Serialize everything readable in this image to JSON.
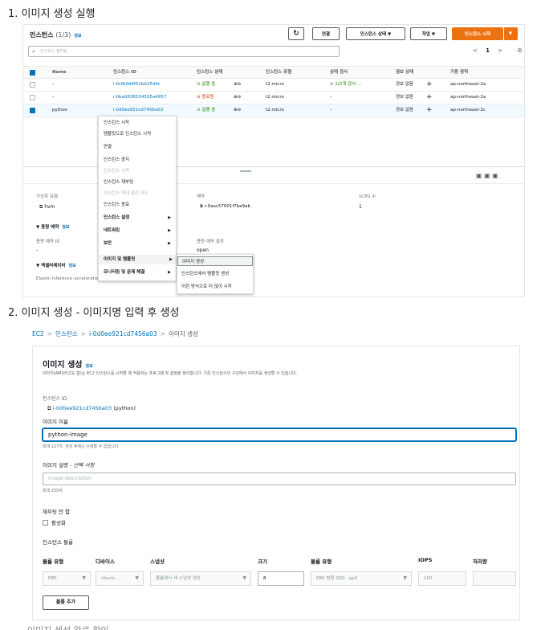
{
  "step1": "1. 이미지 생성 실행",
  "step2": "2. 이미지 생성 - 이미지명 입력 후 생성",
  "instances": {
    "title": "인스턴스",
    "count": "(1/3)",
    "info": "정보",
    "refresh_icon": "refresh-icon",
    "buttons": {
      "connect": "연결",
      "state": "인스턴스 상태 ▼",
      "actions": "작업 ▼",
      "launch": "인스턴스 시작",
      "launch_more": "▼"
    },
    "search_placeholder": "인스턴스 필터링",
    "pager": {
      "prev": "<",
      "page": "1",
      "next": ">",
      "settings": "⚙"
    },
    "columns": [
      "Name",
      "인스턴스 ID",
      "인스턴스 상태",
      "인스턴스 유형",
      "상태 검사",
      "경보 상태",
      "가용 영역"
    ],
    "rows": [
      {
        "name": "–",
        "id": "i-0cfb0d4f51bb25dfd",
        "state": "⊙ 실행 중",
        "zoom": "⊕⊖",
        "type": "t2.micro",
        "check": "⊙ 2/2개 검사 ...",
        "alarm": "경보 없음",
        "plus": "+",
        "az": "ap-northeast-2a"
      },
      {
        "name": "–",
        "id": "i-0ba0836554595a4957",
        "state": "⊖ 종료됨",
        "zoom": "⊕⊖",
        "type": "t2.micro",
        "check": "–",
        "alarm": "경보 없음",
        "plus": "+",
        "az": "ap-northeast-2a"
      },
      {
        "name": "python",
        "id": "i-0d0ee921cd7456a03",
        "state": "⊙ 실행 중",
        "zoom": "⊕⊖",
        "type": "t2.micro",
        "check": "–",
        "alarm": "경보 없음",
        "plus": "+",
        "az": "ap-northeast-2c"
      }
    ],
    "details": {
      "virt_label": "가상화 유형",
      "virt_value": "hvm",
      "lease_label": "예약",
      "lease_value": "r-0aac57001f7be9ab",
      "vcpu_label": "vCPU 수",
      "vcpu_value": "1",
      "capacity_label": "▼ 용량 예약",
      "capacity_info": "정보",
      "cap_id_label": "용량 예약 ID",
      "cap_id_value": "–",
      "cap_setting_label": "용량 예약 설정",
      "cap_setting_value": "open",
      "accel_label": "▼ 액셀러레이터",
      "accel_info": "정보",
      "elastic_label": "Elastic inference accelerator ID"
    },
    "menu": [
      {
        "label": "인스턴스 시작",
        "dis": false
      },
      {
        "label": "템플릿으로 인스턴스 시작",
        "dis": false
      },
      {
        "label": "연결",
        "dis": false
      },
      {
        "label": "인스턴스 중지",
        "dis": false
      },
      {
        "label": "인스턴스 시작",
        "dis": true
      },
      {
        "label": "인스턴스 재부팅",
        "dis": false
      },
      {
        "label": "인스턴스 최대 절전 모드",
        "dis": true
      },
      {
        "label": "인스턴스 종료",
        "dis": false
      },
      {
        "label": "인스턴스 설정",
        "sub": true
      },
      {
        "label": "네트워킹",
        "sub": true
      },
      {
        "label": "보안",
        "sub": true
      },
      {
        "label": "이미지 및 템플릿",
        "sub": true,
        "hl": true
      },
      {
        "label": "모니터링 및 문제 해결",
        "sub": true
      }
    ],
    "submenu": [
      "이미지 생성",
      "인스턴스에서 템플릿 생성",
      "이런 방식으로 더 많이 시작"
    ]
  },
  "create": {
    "breadcrumb": [
      "EC2",
      "인스턴스",
      "i-0d0ee921cd7456a03",
      "이미지 생성"
    ],
    "title": "이미지 생성",
    "info": "정보",
    "description": "이미지(AMI)라고도 함)는 EC2 인스턴스를 시작할 때 적용되는 프로그램 및 설정을 정의합니다. 기존 인스턴스의 구성에서 이미지를 생성할 수 있습니다.",
    "instance_id_label": "인스턴스 ID",
    "instance_id_value": "i-0d0ee921cd7456a03",
    "instance_name": "(python)",
    "image_name_label": "이미지 이름",
    "image_name_value": "python-image",
    "image_name_hint": "최대 127자. 생성 후에는 수정할 수 없습니다.",
    "image_desc_label": "이미지 설명 - ",
    "image_desc_optional": "선택 사항",
    "image_desc_placeholder": "Image description",
    "image_desc_hint": "최대 255자",
    "noreboot_label": "재부팅 안 함",
    "noreboot_checkbox": "활성화",
    "volumes_label": "인스턴스 볼륨",
    "vol_headers": [
      "볼륨 유형",
      "디바이스",
      "스냅샷",
      "크기",
      "볼륨 유형",
      "IOPS",
      "처리량"
    ],
    "vol_row": {
      "type": "EBS",
      "device": "/dev/s...",
      "snapshot": "볼륨에서 새 스냅샷 생성",
      "size": "8",
      "voltype": "EBS 범용 SSD - gp2",
      "iops": "100",
      "throughput": ""
    },
    "add_volume": "볼륨 추가"
  },
  "cutoff_text": "이미지 생성 완료 확인"
}
